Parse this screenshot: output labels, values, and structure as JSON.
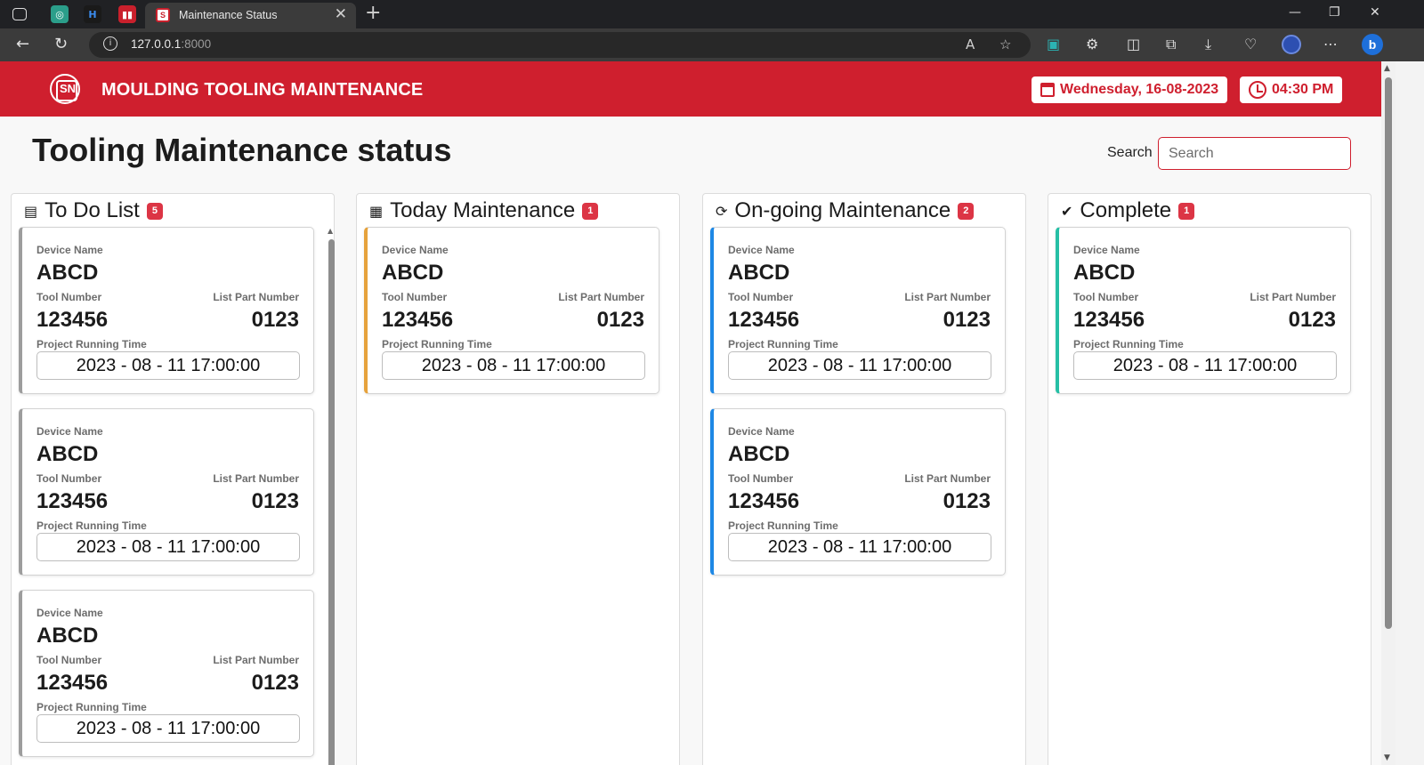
{
  "browser": {
    "tab_title": "Maintenance Status",
    "url_host": "127.0.0.1",
    "url_port": ":8000"
  },
  "header": {
    "title": "MOULDING TOOLING MAINTENANCE",
    "logo_text": "SN",
    "date": "Wednesday, 16-08-2023",
    "time": "04:30 PM"
  },
  "page": {
    "heading": "Tooling Maintenance status",
    "search_label": "Search",
    "search_placeholder": "Search"
  },
  "card_labels": {
    "device": "Device Name",
    "tool": "Tool Number",
    "part": "List Part Number",
    "time": "Project Running Time"
  },
  "columns": [
    {
      "title": "To Do List",
      "count": "5",
      "icon": "clipboard-icon",
      "accent": "#9d9d9d",
      "cards": [
        {
          "device": "ABCD",
          "tool": "123456",
          "part": "0123",
          "time": "2023 - 08 - 11 17:00:00"
        },
        {
          "device": "ABCD",
          "tool": "123456",
          "part": "0123",
          "time": "2023 - 08 - 11 17:00:00"
        },
        {
          "device": "ABCD",
          "tool": "123456",
          "part": "0123",
          "time": "2023 - 08 - 11 17:00:00"
        }
      ]
    },
    {
      "title": "Today Maintenance",
      "count": "1",
      "icon": "calendar-icon",
      "accent": "#e6a23c",
      "cards": [
        {
          "device": "ABCD",
          "tool": "123456",
          "part": "0123",
          "time": "2023 - 08 - 11 17:00:00"
        }
      ]
    },
    {
      "title": "On-going Maintenance",
      "count": "2",
      "icon": "sync-icon",
      "accent": "#1e88e5",
      "cards": [
        {
          "device": "ABCD",
          "tool": "123456",
          "part": "0123",
          "time": "2023 - 08 - 11 17:00:00"
        },
        {
          "device": "ABCD",
          "tool": "123456",
          "part": "0123",
          "time": "2023 - 08 - 11 17:00:00"
        }
      ]
    },
    {
      "title": "Complete",
      "count": "1",
      "icon": "check-circle-icon",
      "accent": "#26bfa5",
      "cards": [
        {
          "device": "ABCD",
          "tool": "123456",
          "part": "0123",
          "time": "2023 - 08 - 11 17:00:00"
        }
      ]
    }
  ]
}
